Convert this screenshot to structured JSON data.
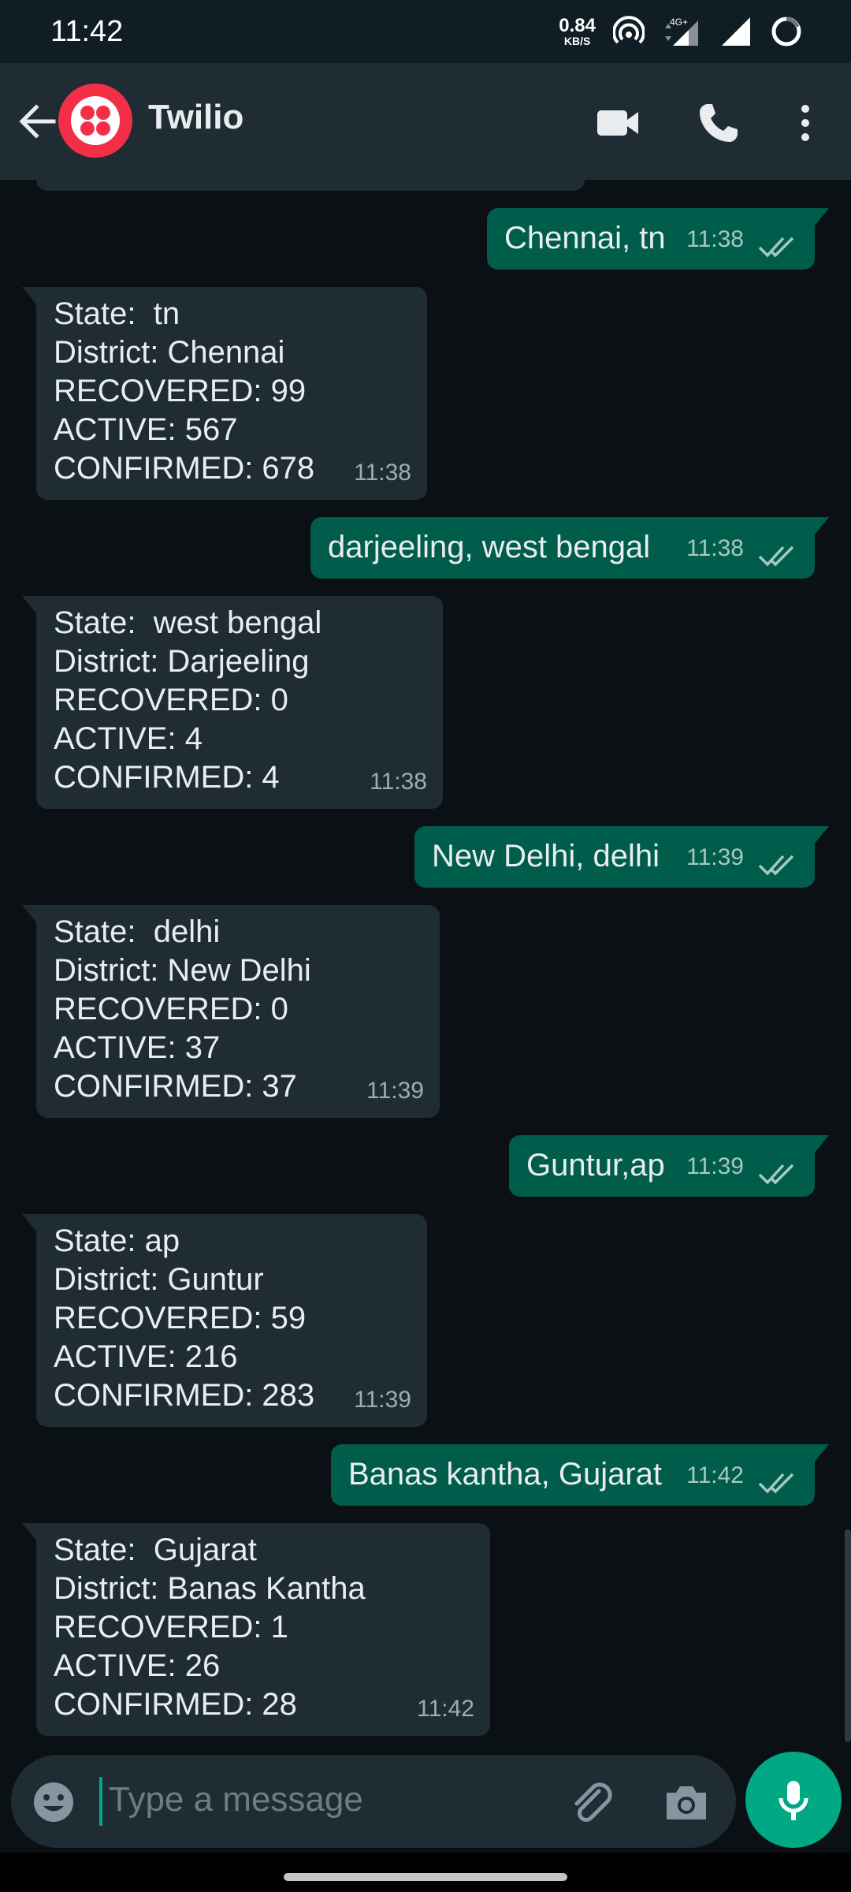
{
  "status_bar": {
    "time": "11:42",
    "net_speed_value": "0.84",
    "net_speed_unit": "KB/S",
    "network_type": "4G+"
  },
  "header": {
    "contact_name": "Twilio",
    "accent_color": "#f22f46"
  },
  "messages": [
    {
      "direction": "out",
      "text": "Chennai, tn",
      "time": "11:38"
    },
    {
      "direction": "in",
      "lines": [
        "State:  tn",
        "District: Chennai",
        "RECOVERED: 99",
        "ACTIVE: 567",
        "CONFIRMED: 678"
      ],
      "time": "11:38"
    },
    {
      "direction": "out",
      "text": "darjeeling, west bengal",
      "time": "11:38"
    },
    {
      "direction": "in",
      "lines": [
        "State:  west bengal",
        "District: Darjeeling",
        "RECOVERED: 0",
        "ACTIVE: 4",
        "CONFIRMED: 4"
      ],
      "time": "11:38"
    },
    {
      "direction": "out",
      "text": "New Delhi, delhi",
      "time": "11:39"
    },
    {
      "direction": "in",
      "lines": [
        "State:  delhi",
        "District: New Delhi",
        "RECOVERED: 0",
        "ACTIVE: 37",
        "CONFIRMED: 37"
      ],
      "time": "11:39"
    },
    {
      "direction": "out",
      "text": "Guntur,ap",
      "time": "11:39"
    },
    {
      "direction": "in",
      "lines": [
        "State: ap",
        "District: Guntur",
        "RECOVERED: 59",
        "ACTIVE: 216",
        "CONFIRMED: 283"
      ],
      "time": "11:39"
    },
    {
      "direction": "out",
      "text": "Banas kantha, Gujarat",
      "time": "11:42"
    },
    {
      "direction": "in",
      "lines": [
        "State:  Gujarat",
        "District: Banas Kantha",
        "RECOVERED: 1",
        "ACTIVE: 26",
        "CONFIRMED: 28"
      ],
      "time": "11:42"
    }
  ],
  "composer": {
    "placeholder": "Type a message"
  },
  "colors": {
    "incoming_bubble": "#1f2c34",
    "outgoing_bubble": "#005c4b",
    "accent": "#00a884",
    "read_ticks": "#a7c8c1"
  },
  "icons": [
    "back-arrow-icon",
    "twilio-logo-icon",
    "video-call-icon",
    "voice-call-icon",
    "more-options-icon",
    "emoji-icon",
    "attach-icon",
    "camera-icon",
    "mic-icon"
  ]
}
